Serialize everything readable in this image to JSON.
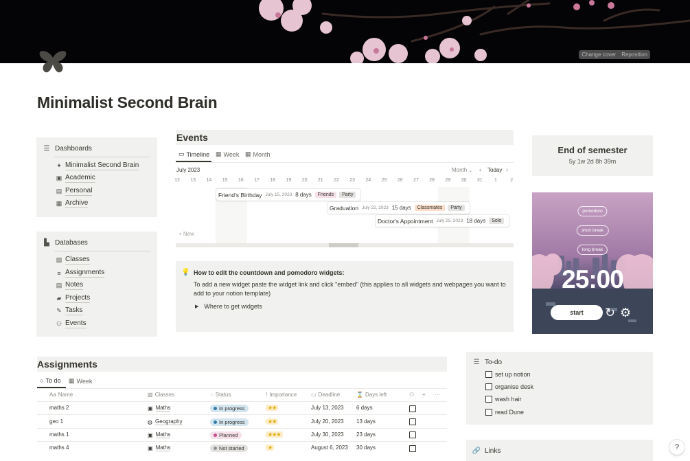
{
  "cover": {
    "change_label": "Change cover",
    "reposition_label": "Reposition"
  },
  "page": {
    "title": "Minimalist Second Brain"
  },
  "dashboards": {
    "title": "Dashboards",
    "items": [
      {
        "label": "Minimalist Second Brain",
        "icon": "butterfly-icon"
      },
      {
        "label": "Academic",
        "icon": "book-icon"
      },
      {
        "label": "Personal",
        "icon": "id-card-icon"
      },
      {
        "label": "Archive",
        "icon": "archive-icon"
      }
    ]
  },
  "databases": {
    "title": "Databases",
    "items": [
      {
        "label": "Classes",
        "icon": "book-pen-icon"
      },
      {
        "label": "Assignments",
        "icon": "checklist-pen-icon"
      },
      {
        "label": "Notes",
        "icon": "note-icon"
      },
      {
        "label": "Projects",
        "icon": "briefcase-icon"
      },
      {
        "label": "Tasks",
        "icon": "edit-icon"
      },
      {
        "label": "Events",
        "icon": "people-icon"
      }
    ]
  },
  "events": {
    "title": "Events",
    "tabs": [
      "Timeline",
      "Week",
      "Month"
    ],
    "month_label": "July 2023",
    "view_select": "Month",
    "today_label": "Today",
    "days": [
      "12",
      "13",
      "14",
      "15",
      "16",
      "17",
      "18",
      "19",
      "20",
      "21",
      "22",
      "23",
      "24",
      "25",
      "26",
      "27",
      "28",
      "29",
      "30",
      "31",
      "1",
      "2"
    ],
    "new_label": "+ New",
    "items": [
      {
        "name": "Friend's Birthday",
        "date": "July 15, 2023",
        "days": "8 days",
        "tags": [
          "Friends",
          "Party"
        ]
      },
      {
        "name": "Graduation",
        "date": "July 22, 2023",
        "days": "15 days",
        "tags": [
          "Classmates",
          "Party"
        ]
      },
      {
        "name": "Doctor's Appointment",
        "date": "July 25, 2023",
        "days": "18 days",
        "tags": [
          "Solo"
        ]
      }
    ]
  },
  "callout": {
    "title": "How to edit the countdown and pomodoro widgets:",
    "body": "To add a new widget paste the widget link and click \"embed\" (this applies to all widgets and webpages you want to add to your notion template)",
    "toggle": "Where to get widgets"
  },
  "countdown": {
    "title": "End of semester",
    "remaining": "5y 1w 2d 8h 39m"
  },
  "pomodoro": {
    "modes": [
      "pomodoro",
      "short break",
      "long break"
    ],
    "time": "25:00",
    "start_label": "start"
  },
  "assignments": {
    "title": "Assignments",
    "tabs": [
      "To do",
      "Week"
    ],
    "columns": [
      "Name",
      "Classes",
      "Status",
      "Importance",
      "Deadline",
      "Days left"
    ],
    "rows": [
      {
        "name": "maths 2",
        "class": "Maths",
        "class_icon": "book-icon",
        "status": "In progress",
        "importance": "★★",
        "deadline": "July 13, 2023",
        "days_left": "6 days"
      },
      {
        "name": "geo 1",
        "class": "Geography",
        "class_icon": "compass-icon",
        "status": "In progress",
        "importance": "★★",
        "deadline": "July 20, 2023",
        "days_left": "13 days"
      },
      {
        "name": "maths 1",
        "class": "Maths",
        "class_icon": "book-icon",
        "status": "Planned",
        "importance": "★★★",
        "deadline": "July 30, 2023",
        "days_left": "23 days"
      },
      {
        "name": "maths 4",
        "class": "Maths",
        "class_icon": "book-icon",
        "status": "Not started",
        "importance": "★",
        "deadline": "August 6, 2023",
        "days_left": "30 days"
      }
    ]
  },
  "todo": {
    "title": "To-do",
    "items": [
      "set up notion",
      "organise desk",
      "wash hair",
      "read Dune"
    ]
  },
  "links": {
    "title": "Links"
  },
  "help": {
    "label": "?"
  },
  "colors": {
    "panel_bg": "#f1f1ef",
    "tag_friends": "#f5e0e9",
    "tag_party": "#e3e2e0",
    "tag_classmates": "#fadec9",
    "tag_solo": "#e3e2e0",
    "status_in_progress": "#d3e5ef",
    "status_planned": "#f5e0e9",
    "status_not_started": "#e3e2e0"
  }
}
